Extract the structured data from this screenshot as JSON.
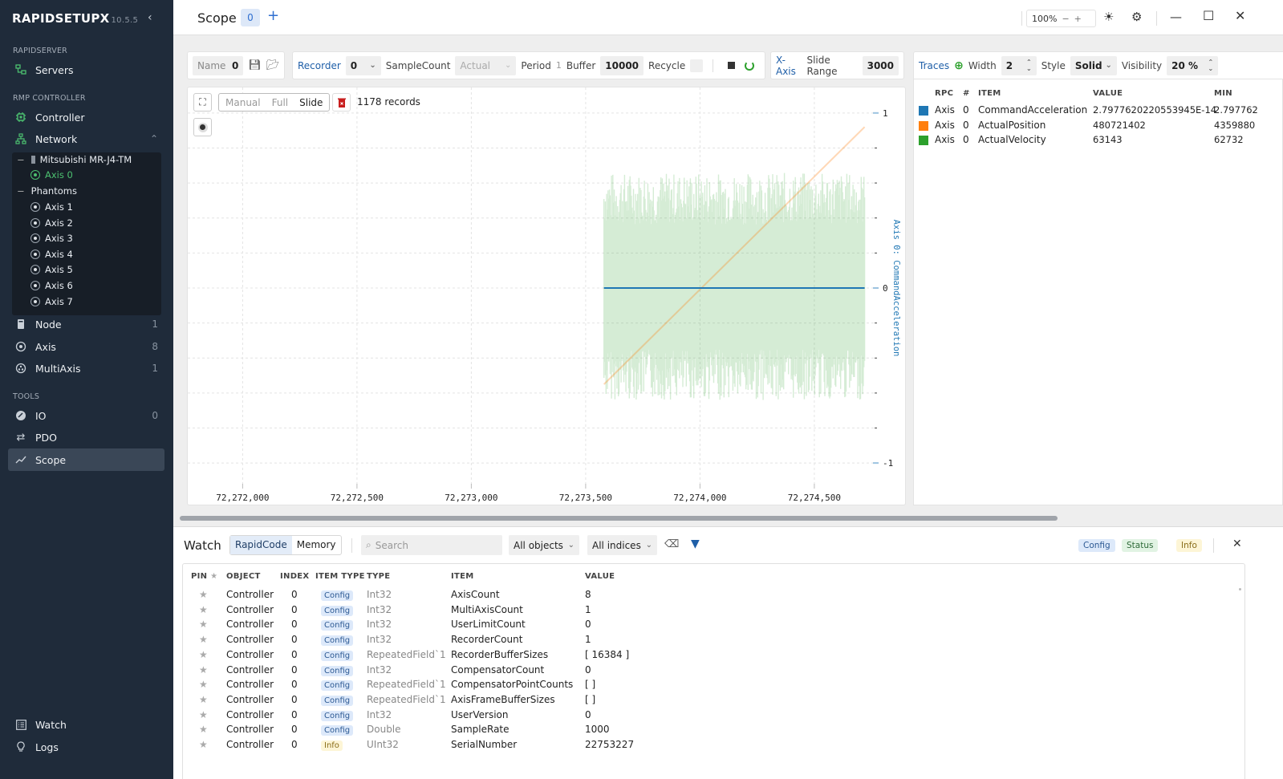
{
  "app": {
    "name": "RAPIDSETUPX",
    "version": "10.5.5"
  },
  "sidebar": {
    "sections": {
      "rapidserver": "RAPIDSERVER",
      "rmp_controller": "RMP CONTROLLER",
      "tools": "TOOLS"
    },
    "servers": "Servers",
    "controller": "Controller",
    "network": "Network",
    "tree": {
      "node": "Mitsubishi MR-J4-TM",
      "node_axis": "Axis 0",
      "phantoms": "Phantoms",
      "phantom_axes": [
        "Axis 1",
        "Axis 2",
        "Axis 3",
        "Axis 4",
        "Axis 5",
        "Axis 6",
        "Axis 7"
      ]
    },
    "items": [
      {
        "label": "Node",
        "count": "1"
      },
      {
        "label": "Axis",
        "count": "8"
      },
      {
        "label": "MultiAxis",
        "count": "1"
      }
    ],
    "tools": [
      {
        "label": "IO",
        "count": "0"
      },
      {
        "label": "PDO",
        "count": ""
      },
      {
        "label": "Scope",
        "count": ""
      }
    ],
    "bottom": [
      {
        "label": "Watch"
      },
      {
        "label": "Logs"
      }
    ]
  },
  "header": {
    "title": "Scope",
    "tab": "0",
    "add": "+",
    "zoom": "100%"
  },
  "toolbar": {
    "name_label": "Name",
    "name_value": "0",
    "recorder_label": "Recorder",
    "recorder_value": "0",
    "samplecount_label": "SampleCount",
    "samplecount_value": "Actual",
    "period_label": "Period",
    "period_value": "1",
    "buffer_label": "Buffer",
    "buffer_value": "10000",
    "recycle_label": "Recycle",
    "xaxis_label": "X-Axis",
    "slide_range_label": "Slide Range",
    "slide_range_value": "3000",
    "traces_label": "Traces",
    "width_label": "Width",
    "width_value": "2",
    "style_label": "Style",
    "style_value": "Solid",
    "visibility_label": "Visibility",
    "visibility_value": "20 %"
  },
  "plot": {
    "modes": [
      "Manual",
      "Full",
      "Slide"
    ],
    "active_mode": "Slide",
    "records": "1178 records"
  },
  "chart_data": {
    "type": "line",
    "x_ticks": [
      "72,272,000",
      "72,272,500",
      "72,273,000",
      "72,273,500",
      "72,274,000",
      "72,274,500"
    ],
    "xlim": [
      72271760,
      72274760
    ],
    "y_ticks": [
      "1",
      "0",
      "-1"
    ],
    "ylim": [
      -1.1,
      1.1
    ],
    "ylabel": "Axis 0: CommandAcceleration",
    "grid": true,
    "data_x_range": [
      72273580,
      72274720
    ],
    "series": [
      {
        "name": "CommandAcceleration",
        "color": "#1f77b4",
        "shape": "flat",
        "values_normalized": [
          0,
          0
        ]
      },
      {
        "name": "ActualPosition",
        "color": "#ff7f0e",
        "shape": "ramp",
        "values_normalized": [
          -0.55,
          0.92
        ]
      },
      {
        "name": "ActualVelocity",
        "color": "#2ca02c",
        "shape": "noise",
        "values_normalized": [
          -0.64,
          0.66
        ]
      }
    ]
  },
  "traces": {
    "headers": [
      "RPC",
      "#",
      "ITEM",
      "VALUE",
      "MIN"
    ],
    "rows": [
      {
        "color": "#1f77b4",
        "rpc": "Axis",
        "num": "0",
        "item": "CommandAcceleration",
        "value": "2.7977620220553945E-14",
        "min": "2.797762"
      },
      {
        "color": "#ff7f0e",
        "rpc": "Axis",
        "num": "0",
        "item": "ActualPosition",
        "value": "480721402",
        "min": "4359880"
      },
      {
        "color": "#2ca02c",
        "rpc": "Axis",
        "num": "0",
        "item": "ActualVelocity",
        "value": "63143",
        "min": "62732"
      }
    ]
  },
  "watch": {
    "title": "Watch",
    "tabs": [
      "RapidCode",
      "Memory"
    ],
    "search_placeholder": "Search",
    "objects": "All objects",
    "indices": "All indices",
    "filters": [
      "Config",
      "Status",
      "Info"
    ],
    "headers": [
      "PIN",
      "OBJECT",
      "INDEX",
      "ITEM TYPE",
      "TYPE",
      "ITEM",
      "VALUE"
    ],
    "rows": [
      {
        "object": "Controller",
        "index": "0",
        "item_type": "Config",
        "type": "Int32",
        "item": "AxisCount",
        "value": "8"
      },
      {
        "object": "Controller",
        "index": "0",
        "item_type": "Config",
        "type": "Int32",
        "item": "MultiAxisCount",
        "value": "1"
      },
      {
        "object": "Controller",
        "index": "0",
        "item_type": "Config",
        "type": "Int32",
        "item": "UserLimitCount",
        "value": "0"
      },
      {
        "object": "Controller",
        "index": "0",
        "item_type": "Config",
        "type": "Int32",
        "item": "RecorderCount",
        "value": "1"
      },
      {
        "object": "Controller",
        "index": "0",
        "item_type": "Config",
        "type": "RepeatedField`1",
        "item": "RecorderBufferSizes",
        "value": "[ 16384 ]"
      },
      {
        "object": "Controller",
        "index": "0",
        "item_type": "Config",
        "type": "Int32",
        "item": "CompensatorCount",
        "value": "0"
      },
      {
        "object": "Controller",
        "index": "0",
        "item_type": "Config",
        "type": "RepeatedField`1",
        "item": "CompensatorPointCounts",
        "value": "[ ]"
      },
      {
        "object": "Controller",
        "index": "0",
        "item_type": "Config",
        "type": "RepeatedField`1",
        "item": "AxisFrameBufferSizes",
        "value": "[ ]"
      },
      {
        "object": "Controller",
        "index": "0",
        "item_type": "Config",
        "type": "Int32",
        "item": "UserVersion",
        "value": "0"
      },
      {
        "object": "Controller",
        "index": "0",
        "item_type": "Config",
        "type": "Double",
        "item": "SampleRate",
        "value": "1000"
      },
      {
        "object": "Controller",
        "index": "0",
        "item_type": "Info",
        "type": "UInt32",
        "item": "SerialNumber",
        "value": "22753227"
      }
    ]
  }
}
